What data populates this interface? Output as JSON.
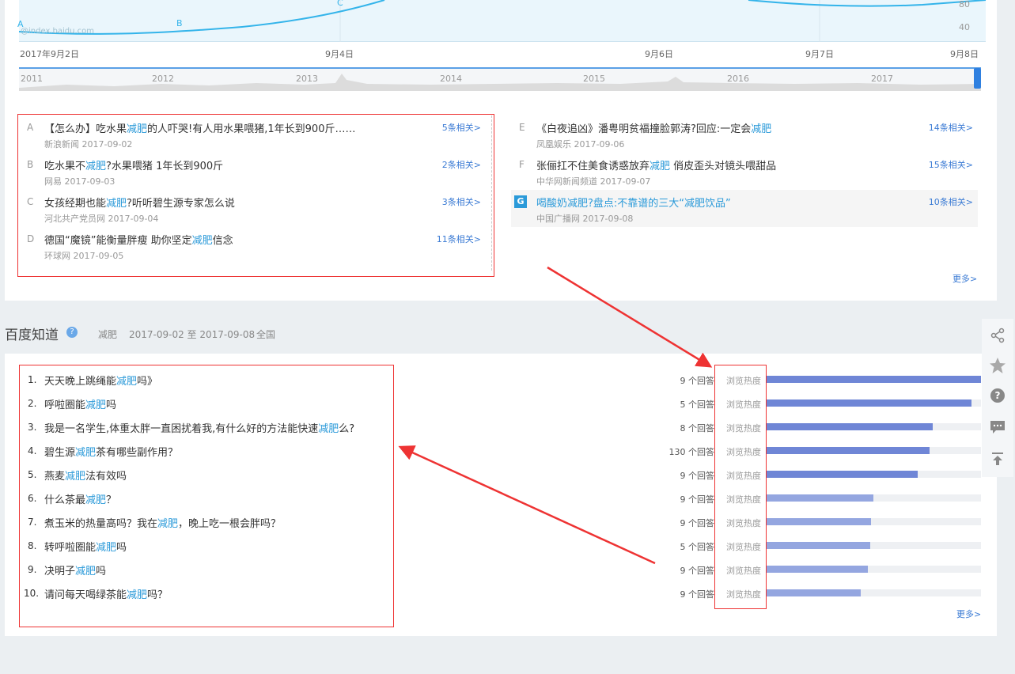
{
  "chart": {
    "watermark": "@index.baidu.com",
    "y_ticks": [
      "80",
      "40"
    ],
    "point_labels": [
      "A",
      "B",
      "C"
    ],
    "x_labels": [
      "2017年9月2日",
      "9月4日",
      "9月6日",
      "9月7日",
      "9月8日"
    ],
    "timeline_years": [
      "2011",
      "2012",
      "2013",
      "2014",
      "2015",
      "2016",
      "2017"
    ]
  },
  "news": {
    "left": [
      {
        "letter": "A",
        "pre": "【怎么办】吃水果",
        "kw": "减肥",
        "post": "的人吓哭!有人用水果喂猪,1年长到900斤……",
        "source": "新浪新闻 2017-09-02",
        "related": "5条相关>"
      },
      {
        "letter": "B",
        "pre": "吃水果不",
        "kw": "减肥",
        "post": "?水果喂猪 1年长到900斤",
        "source": "网易 2017-09-03",
        "related": "2条相关>"
      },
      {
        "letter": "C",
        "pre": "女孩经期也能",
        "kw": "减肥",
        "post": "?听听碧生源专家怎么说",
        "source": "河北共产党员网 2017-09-04",
        "related": "3条相关>"
      },
      {
        "letter": "D",
        "pre": "德国“魔镜”能衡量胖瘦 助你坚定",
        "kw": "减肥",
        "post": "信念",
        "source": "环球网 2017-09-05",
        "related": "11条相关>"
      }
    ],
    "right": [
      {
        "letter": "E",
        "pre": "《白夜追凶》潘粤明贫福撞脸郭涛?回应:一定会",
        "kw": "减肥",
        "post": "",
        "source": "凤凰娱乐 2017-09-06",
        "related": "14条相关>"
      },
      {
        "letter": "F",
        "pre": "张俪扛不住美食诱惑放弃",
        "kw": "减肥",
        "post": " 俏皮歪头对镜头喂甜品",
        "source": "中华网新闻频道 2017-09-07",
        "related": "15条相关>"
      },
      {
        "letter": "G",
        "pre": "喝酸奶减肥?盘点:不靠谱的三大“减肥饮品”",
        "kw": "",
        "post": "",
        "source": "中国广播网 2017-09-08",
        "related": "10条相关>"
      }
    ],
    "more": "更多>"
  },
  "zhidao": {
    "title": "百度知道",
    "keyword": "减肥",
    "range": "2017-09-02 至 2017-09-08",
    "region": "全国",
    "heat_label": "浏览热度",
    "more": "更多>",
    "items": [
      {
        "num": "1.",
        "pre": "天天晚上跳绳能",
        "kw": "减肥",
        "post": "吗》",
        "answers": "9 个回答",
        "heat": 1.0
      },
      {
        "num": "2.",
        "pre": "呼啦圈能",
        "kw": "减肥",
        "post": "吗",
        "answers": "5 个回答",
        "heat": 0.955
      },
      {
        "num": "3.",
        "pre": "我是一名学生,体重太胖一直困扰着我,有什么好的方法能快速",
        "kw": "减肥",
        "post": "么?",
        "answers": "8 个回答",
        "heat": 0.775
      },
      {
        "num": "4.",
        "pre": "碧生源",
        "kw": "减肥",
        "post": "茶有哪些副作用？",
        "answers": "130 个回答",
        "heat": 0.76
      },
      {
        "num": "5.",
        "pre": "燕麦",
        "kw": "减肥",
        "post": "法有效吗",
        "answers": "9 个回答",
        "heat": 0.705
      },
      {
        "num": "6.",
        "pre": "什么茶最",
        "kw": "减肥",
        "post": "？",
        "answers": "9 个回答",
        "heat": 0.5
      },
      {
        "num": "7.",
        "pre": "煮玉米的热量高吗？我在",
        "kw": "减肥",
        "post": "，晚上吃一根会胖吗？",
        "answers": "9 个回答",
        "heat": 0.49
      },
      {
        "num": "8.",
        "pre": "转呼啦圈能",
        "kw": "减肥",
        "post": "吗",
        "answers": "5 个回答",
        "heat": 0.485
      },
      {
        "num": "9.",
        "pre": "决明子",
        "kw": "减肥",
        "post": "吗",
        "answers": "9 个回答",
        "heat": 0.475
      },
      {
        "num": "10.",
        "pre": "请问每天喝绿茶能",
        "kw": "减肥",
        "post": "吗？",
        "answers": "9 个回答",
        "heat": 0.44
      }
    ]
  },
  "colors": {
    "accent": "#2b9ad9",
    "bar_strong": "#6f86d6",
    "bar_light": "#94a6e0",
    "annotation": "#e33"
  }
}
